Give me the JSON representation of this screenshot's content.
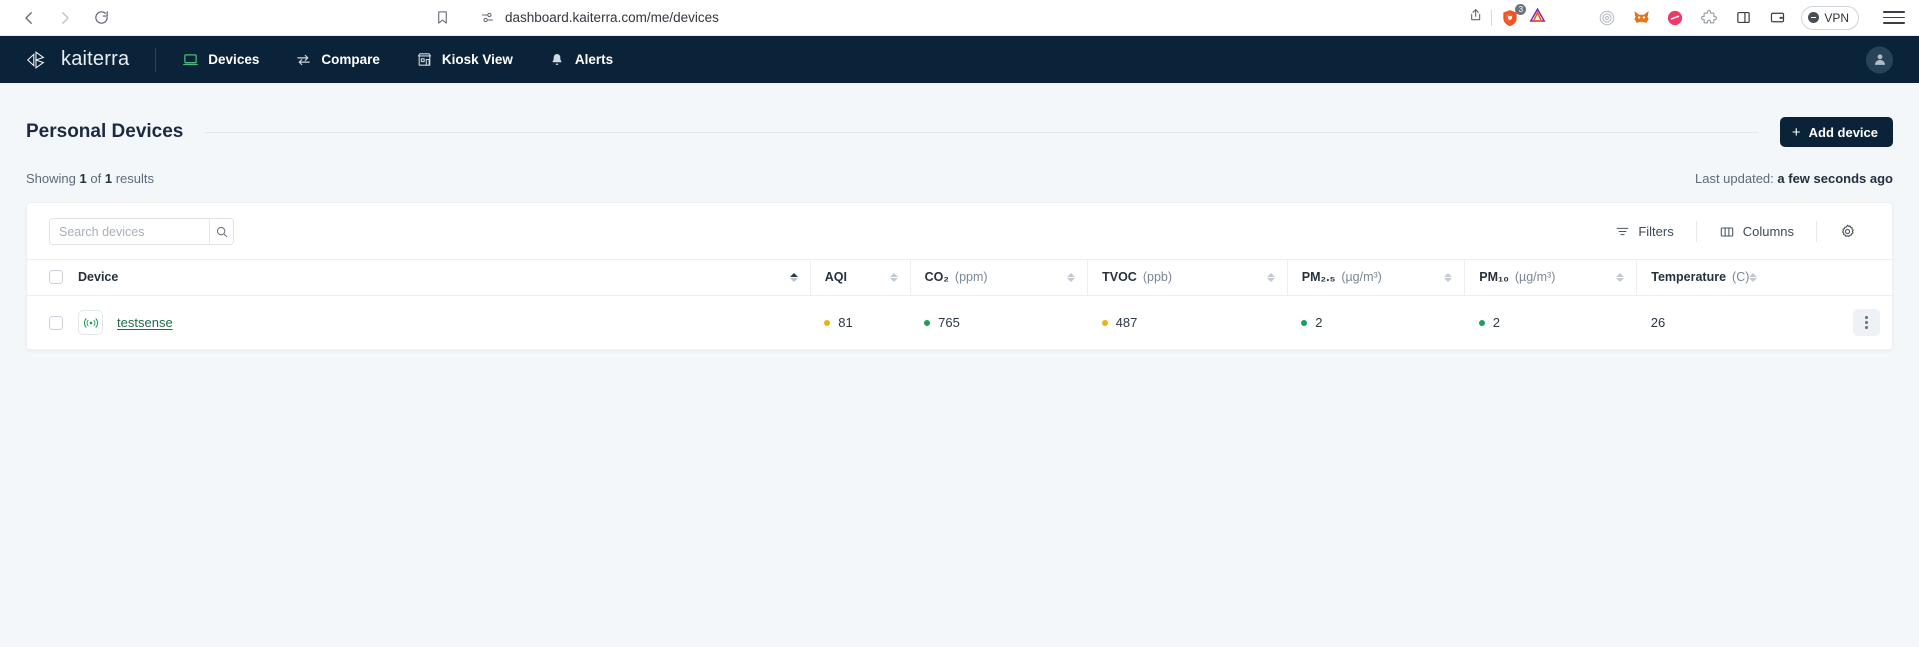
{
  "browser": {
    "back_icon": "chevron-left-icon",
    "forward_icon": "chevron-right-icon",
    "reload_icon": "reload-icon",
    "bookmark_icon": "bookmark-icon",
    "site_settings_icon": "site-settings-icon",
    "url": "dashboard.kaiterra.com/me/devices",
    "share_icon": "share-icon",
    "brave_shields_icon": "brave-shields-icon",
    "brave_shields_count": "3",
    "brave_rewards_icon": "brave-rewards-triangle-icon",
    "extensions": [
      {
        "name": "spiral-extension-icon",
        "color": "#b9bec6"
      },
      {
        "name": "metamask-fox-icon",
        "color": "#e2761b"
      },
      {
        "name": "pink-circle-extension-icon",
        "color": "#ef3b6b"
      },
      {
        "name": "puzzle-extensions-icon",
        "color": "#9aa3ad"
      },
      {
        "name": "sidebar-panel-icon",
        "color": "#3a3f46"
      },
      {
        "name": "wallet-icon",
        "color": "#3a3f46"
      }
    ],
    "vpn_label": "VPN",
    "menu_icon": "hamburger-menu-icon"
  },
  "app_nav": {
    "brand": "kaiterra",
    "brand_icon": "kaiterra-logo-icon",
    "items": [
      {
        "label": "Devices",
        "icon": "laptop-icon",
        "active": true
      },
      {
        "label": "Compare",
        "icon": "compare-arrows-icon",
        "active": false
      },
      {
        "label": "Kiosk View",
        "icon": "kiosk-icon",
        "active": false
      },
      {
        "label": "Alerts",
        "icon": "bell-icon",
        "active": false
      }
    ],
    "avatar_icon": "user-avatar-icon",
    "bg_color": "#0b2338"
  },
  "page": {
    "title": "Personal Devices",
    "add_device_label": "Add device",
    "add_device_icon": "plus-icon",
    "showing_prefix": "Showing",
    "showing_count": "1",
    "showing_mid": "of",
    "showing_total": "1",
    "showing_suffix": "results",
    "last_updated_label": "Last updated:",
    "last_updated_value": "a few seconds ago"
  },
  "toolbar": {
    "search_placeholder": "Search devices",
    "search_value": "",
    "search_icon": "search-icon",
    "filters_label": "Filters",
    "filters_icon": "filter-icon",
    "columns_label": "Columns",
    "columns_icon": "columns-icon",
    "settings_icon": "gear-icon"
  },
  "table": {
    "select_all_checked": false,
    "columns": [
      {
        "label": "Device",
        "unit": "",
        "sortable": true,
        "sort_state": "asc"
      },
      {
        "label": "AQI",
        "unit": "",
        "sortable": true,
        "sort_state": "none"
      },
      {
        "label": "CO₂",
        "unit": "(ppm)",
        "sortable": true,
        "sort_state": "none"
      },
      {
        "label": "TVOC",
        "unit": "(ppb)",
        "sortable": true,
        "sort_state": "none"
      },
      {
        "label": "PM₂.₅",
        "unit": "(µg/m³)",
        "sortable": true,
        "sort_state": "none"
      },
      {
        "label": "PM₁₀",
        "unit": "(µg/m³)",
        "sortable": true,
        "sort_state": "none"
      },
      {
        "label": "Temperature",
        "unit": "(C)",
        "sortable": true,
        "sort_state": "none"
      }
    ],
    "rows": [
      {
        "checked": false,
        "device_icon": "sensor-signal-icon",
        "device_name": "testsense",
        "aqi": {
          "value": "81",
          "color": "#e8b21c"
        },
        "co2": {
          "value": "765",
          "color": "#1e9e5a"
        },
        "tvoc": {
          "value": "487",
          "color": "#e8b21c"
        },
        "pm25": {
          "value": "2",
          "color": "#1e9e5a"
        },
        "pm10": {
          "value": "2",
          "color": "#1e9e5a"
        },
        "temperature": {
          "value": "26",
          "color": ""
        },
        "menu_icon": "more-vertical-icon"
      }
    ]
  },
  "colors": {
    "nav_bg": "#0b2338",
    "page_bg": "#f4f7fa",
    "card_bg": "#ffffff",
    "link_green": "#1f6b4a",
    "good_green": "#1e9e5a",
    "moderate_yellow": "#e8b21c"
  }
}
